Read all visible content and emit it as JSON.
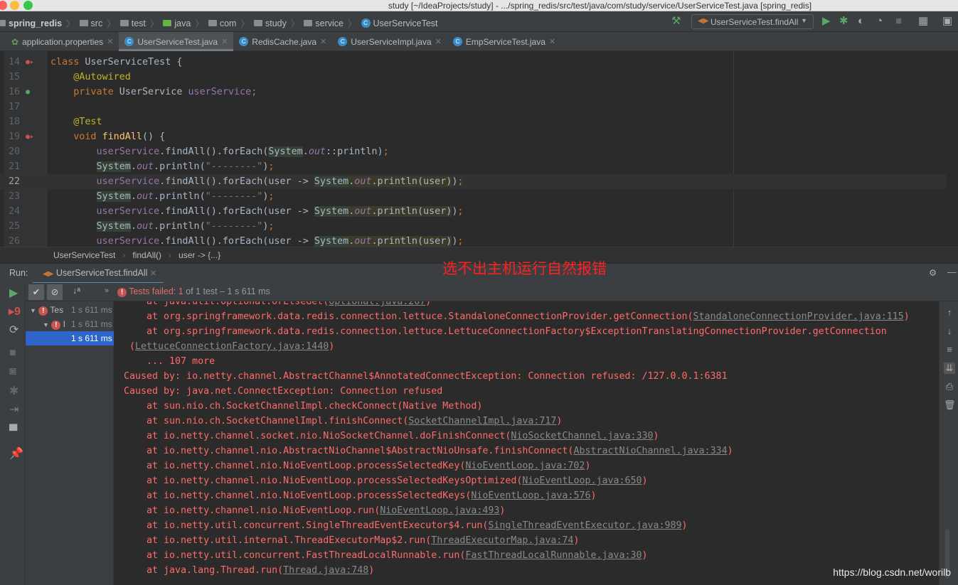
{
  "window": {
    "title": "study [~/IdeaProjects/study] - .../spring_redis/src/test/java/com/study/service/UserServiceTest.java [spring_redis]"
  },
  "breadcrumbs": [
    "spring_redis",
    "src",
    "test",
    "java",
    "com",
    "study",
    "service",
    "UserServiceTest"
  ],
  "toolbar": {
    "run_config": "UserServiceTest.findAll"
  },
  "tabs": [
    {
      "label": "application.properties",
      "active": false
    },
    {
      "label": "UserServiceTest.java",
      "active": true
    },
    {
      "label": "RedisCache.java",
      "active": false
    },
    {
      "label": "UserServiceImpl.java",
      "active": false
    },
    {
      "label": "EmpServiceTest.java",
      "active": false
    }
  ],
  "code": {
    "current_line": 22,
    "lines": [
      {
        "n": "14",
        "tokens": [
          [
            "class ",
            "keyword"
          ],
          [
            "UserServiceTest {",
            "plain"
          ]
        ]
      },
      {
        "n": "15",
        "tokens": [
          [
            "    @Autowired",
            "annotation"
          ]
        ]
      },
      {
        "n": "16",
        "tokens": [
          [
            "    private ",
            "keyword"
          ],
          [
            "UserService ",
            "plain"
          ],
          [
            "userService",
            "field"
          ],
          [
            ";",
            "keyword"
          ]
        ]
      },
      {
        "n": "17",
        "tokens": []
      },
      {
        "n": "18",
        "tokens": [
          [
            "    @Test",
            "annotation"
          ]
        ]
      },
      {
        "n": "19",
        "tokens": [
          [
            "    void ",
            "keyword"
          ],
          [
            "findAll",
            "method"
          ],
          [
            "() {",
            "plain"
          ]
        ]
      },
      {
        "n": "20",
        "tokens": [
          [
            "        ",
            "plain"
          ],
          [
            "userService",
            "field"
          ],
          [
            ".findAll().forEach(",
            "plain"
          ],
          [
            "System",
            "plain hl"
          ],
          [
            ".",
            "plain"
          ],
          [
            "out",
            "static"
          ],
          [
            "::println)",
            "plain"
          ],
          [
            ";",
            "keyword"
          ]
        ]
      },
      {
        "n": "21",
        "tokens": [
          [
            "        ",
            "plain"
          ],
          [
            "System",
            "plain hl"
          ],
          [
            ".",
            "plain"
          ],
          [
            "out",
            "static"
          ],
          [
            ".println(",
            "plain"
          ],
          [
            "\"--------\"",
            "string"
          ],
          [
            ")",
            "plain"
          ],
          [
            ";",
            "keyword"
          ]
        ]
      },
      {
        "n": "22",
        "tokens": [
          [
            "        ",
            "plain"
          ],
          [
            "userService",
            "field"
          ],
          [
            ".findAll().forEach(user -> ",
            "plain"
          ],
          [
            "System",
            "plain hl"
          ],
          [
            ".",
            "plain hl2"
          ],
          [
            "out",
            "static hl2"
          ],
          [
            ".println(user)",
            "plain hl2"
          ],
          [
            ")",
            "plain"
          ],
          [
            ";",
            "keyword"
          ]
        ]
      },
      {
        "n": "23",
        "tokens": [
          [
            "        ",
            "plain"
          ],
          [
            "System",
            "plain hl"
          ],
          [
            ".",
            "plain"
          ],
          [
            "out",
            "static"
          ],
          [
            ".println(",
            "plain"
          ],
          [
            "\"--------\"",
            "string"
          ],
          [
            ")",
            "plain"
          ],
          [
            ";",
            "keyword"
          ]
        ]
      },
      {
        "n": "24",
        "tokens": [
          [
            "        ",
            "plain"
          ],
          [
            "userService",
            "field"
          ],
          [
            ".findAll().forEach(user -> ",
            "plain"
          ],
          [
            "System",
            "plain hl"
          ],
          [
            ".",
            "plain hl2"
          ],
          [
            "out",
            "static hl2"
          ],
          [
            ".println(user)",
            "plain hl2"
          ],
          [
            ")",
            "plain"
          ],
          [
            ";",
            "keyword"
          ]
        ]
      },
      {
        "n": "25",
        "tokens": [
          [
            "        ",
            "plain"
          ],
          [
            "System",
            "plain hl"
          ],
          [
            ".",
            "plain"
          ],
          [
            "out",
            "static"
          ],
          [
            ".println(",
            "plain"
          ],
          [
            "\"--------\"",
            "string"
          ],
          [
            ")",
            "plain"
          ],
          [
            ";",
            "keyword"
          ]
        ]
      },
      {
        "n": "26",
        "tokens": [
          [
            "        ",
            "plain"
          ],
          [
            "userService",
            "field"
          ],
          [
            ".findAll().forEach(user -> ",
            "plain"
          ],
          [
            "System",
            "plain hl"
          ],
          [
            ".",
            "plain hl2"
          ],
          [
            "out",
            "static hl2"
          ],
          [
            ".println(user)",
            "plain hl2"
          ],
          [
            ")",
            "plain"
          ],
          [
            ";",
            "keyword"
          ]
        ]
      }
    ]
  },
  "editor_breadcrumb": [
    "UserServiceTest",
    "findAll()",
    "user -> {...}"
  ],
  "run": {
    "label": "Run:",
    "tab": "UserServiceTest.findAll",
    "status_failed": "Tests failed: 1",
    "status_rest": " of 1 test – 1 s 611 ms",
    "tree": [
      {
        "label": "Tes",
        "time": "1 s 611 ms"
      },
      {
        "label": "I",
        "time": "1 s 611 ms"
      },
      {
        "label": "",
        "time": "1 s 611 ms"
      }
    ]
  },
  "console": [
    {
      "i": "    ",
      "pre": "at java.util.Optional.orElseGet(",
      "link": "Optional.java:267",
      "post": ")"
    },
    {
      "i": "    ",
      "pre": "at org.springframework.data.redis.connection.lettuce.StandaloneConnectionProvider.getConnection(",
      "link": "StandaloneConnectionProvider.java:115",
      "post": ")"
    },
    {
      "i": "    ",
      "pre": "at org.springframework.data.redis.connection.lettuce.LettuceConnectionFactory$ExceptionTranslatingConnectionProvider.getConnection",
      "link": "",
      "post": ""
    },
    {
      "i": "",
      "pre": " (",
      "link": "LettuceConnectionFactory.java:1440",
      "post": ")"
    },
    {
      "i": "    ",
      "pre": "... 107 more",
      "link": "",
      "post": ""
    },
    {
      "i": "",
      "pre": "Caused by: io.netty.channel.AbstractChannel$AnnotatedConnectException: Connection refused: /127.0.0.1:6381",
      "link": "",
      "post": ""
    },
    {
      "i": "",
      "pre": "Caused by: java.net.ConnectException: Connection refused",
      "link": "",
      "post": ""
    },
    {
      "i": "    ",
      "pre": "at sun.nio.ch.SocketChannelImpl.checkConnect(Native Method)",
      "link": "",
      "post": ""
    },
    {
      "i": "    ",
      "pre": "at sun.nio.ch.SocketChannelImpl.finishConnect(",
      "link": "SocketChannelImpl.java:717",
      "post": ")"
    },
    {
      "i": "    ",
      "pre": "at io.netty.channel.socket.nio.NioSocketChannel.doFinishConnect(",
      "link": "NioSocketChannel.java:330",
      "post": ")"
    },
    {
      "i": "    ",
      "pre": "at io.netty.channel.nio.AbstractNioChannel$AbstractNioUnsafe.finishConnect(",
      "link": "AbstractNioChannel.java:334",
      "post": ")"
    },
    {
      "i": "    ",
      "pre": "at io.netty.channel.nio.NioEventLoop.processSelectedKey(",
      "link": "NioEventLoop.java:702",
      "post": ")"
    },
    {
      "i": "    ",
      "pre": "at io.netty.channel.nio.NioEventLoop.processSelectedKeysOptimized(",
      "link": "NioEventLoop.java:650",
      "post": ")"
    },
    {
      "i": "    ",
      "pre": "at io.netty.channel.nio.NioEventLoop.processSelectedKeys(",
      "link": "NioEventLoop.java:576",
      "post": ")"
    },
    {
      "i": "    ",
      "pre": "at io.netty.channel.nio.NioEventLoop.run(",
      "link": "NioEventLoop.java:493",
      "post": ")"
    },
    {
      "i": "    ",
      "pre": "at io.netty.util.concurrent.SingleThreadEventExecutor$4.run(",
      "link": "SingleThreadEventExecutor.java:989",
      "post": ")"
    },
    {
      "i": "    ",
      "pre": "at io.netty.util.internal.ThreadExecutorMap$2.run(",
      "link": "ThreadExecutorMap.java:74",
      "post": ")"
    },
    {
      "i": "    ",
      "pre": "at io.netty.util.concurrent.FastThreadLocalRunnable.run(",
      "link": "FastThreadLocalRunnable.java:30",
      "post": ")"
    },
    {
      "i": "    ",
      "pre": "at java.lang.Thread.run(",
      "link": "Thread.java:748",
      "post": ")"
    }
  ],
  "annotation": "选不出主机运行自然报错",
  "watermark": "https://blog.csdn.net/worilb",
  "colors": {
    "error": "#ff6b68",
    "accent": "#4a88c7",
    "annotation": "#ff2020"
  }
}
